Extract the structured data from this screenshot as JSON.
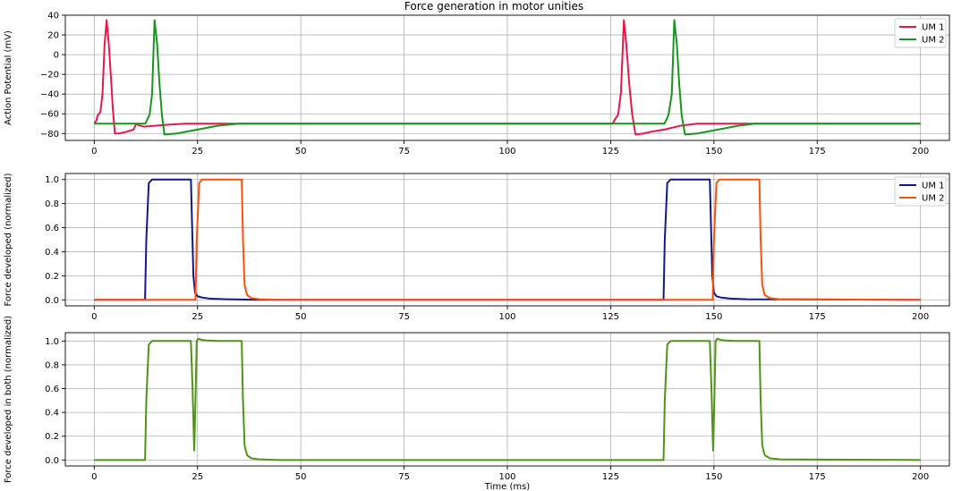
{
  "title": "Force generation in motor unities",
  "chart_data": [
    {
      "type": "line",
      "name": "action-potential",
      "ylabel": "Action Potential (mV)",
      "xlabel": "",
      "xlim": [
        -7,
        207
      ],
      "ylim": [
        -87,
        40
      ],
      "xticks": [
        0,
        25,
        50,
        75,
        100,
        125,
        150,
        175,
        200
      ],
      "yticks": [
        -80,
        -60,
        -40,
        -20,
        0,
        20,
        40
      ],
      "grid": true,
      "legend": "top-right",
      "series": [
        {
          "name": "UM 1",
          "color": "#e8174a",
          "x": [
            0,
            0.5,
            0.8,
            1.5,
            2.0,
            2.5,
            3.0,
            3.5,
            4.0,
            4.5,
            5.0,
            6,
            8,
            9.5,
            10.2,
            11,
            12,
            15,
            18,
            22,
            25,
            30,
            40,
            60,
            80,
            100,
            120,
            125.5,
            126,
            126.8,
            127.5,
            128.2,
            128.8,
            129.5,
            130.2,
            131,
            133,
            135,
            138,
            142,
            146,
            150,
            160,
            200
          ],
          "y": [
            -70,
            -67,
            -62,
            -58,
            -40,
            10,
            35,
            12,
            -20,
            -55,
            -80,
            -80,
            -78,
            -76,
            -70,
            -72,
            -73,
            -72,
            -71,
            -70,
            -70,
            -70,
            -70,
            -70,
            -70,
            -70,
            -70,
            -70,
            -66,
            -61,
            -38,
            35,
            10,
            -30,
            -60,
            -81,
            -80,
            -78,
            -76,
            -72,
            -70,
            -70,
            -70,
            -70
          ]
        },
        {
          "name": "UM 2",
          "color": "#17961e",
          "x": [
            0,
            5,
            10,
            12.4,
            12.8,
            13.4,
            14.0,
            14.6,
            15.2,
            15.8,
            16.4,
            17.0,
            20,
            25,
            30,
            35,
            40,
            60,
            100,
            120,
            138,
            138.5,
            139,
            139.8,
            140.4,
            141.0,
            141.6,
            142.2,
            143,
            146,
            151,
            156,
            160,
            200
          ],
          "y": [
            -70,
            -70,
            -70,
            -70,
            -66,
            -61,
            -40,
            35,
            12,
            -30,
            -62,
            -81,
            -80,
            -76,
            -72,
            -70,
            -70,
            -70,
            -70,
            -70,
            -70,
            -66,
            -61,
            -40,
            35,
            12,
            -30,
            -62,
            -81,
            -80,
            -76,
            -72,
            -70,
            -70
          ]
        }
      ]
    },
    {
      "type": "line",
      "name": "force-each",
      "ylabel": "Force developed (normalized)",
      "xlabel": "",
      "xlim": [
        -7,
        207
      ],
      "ylim": [
        -0.05,
        1.05
      ],
      "xticks": [
        0,
        25,
        50,
        75,
        100,
        125,
        150,
        175,
        200
      ],
      "yticks": [
        0.0,
        0.2,
        0.4,
        0.6,
        0.8,
        1.0
      ],
      "grid": true,
      "legend": "top-right",
      "series": [
        {
          "name": "UM 1",
          "color": "#0f198c",
          "x": [
            0,
            12.3,
            12.6,
            13.2,
            14,
            23.4,
            23.7,
            24.0,
            24.4,
            25.0,
            26,
            28,
            32,
            40,
            137.8,
            138.1,
            138.7,
            139.5,
            149.0,
            149.3,
            149.6,
            150.0,
            150.6,
            151.6,
            154,
            158,
            200
          ],
          "y": [
            0,
            0,
            0.5,
            0.97,
            1.0,
            1.0,
            0.6,
            0.2,
            0.06,
            0.03,
            0.02,
            0.01,
            0.005,
            0,
            0,
            0.5,
            0.97,
            1.0,
            1.0,
            0.6,
            0.2,
            0.06,
            0.03,
            0.02,
            0.01,
            0.005,
            0
          ]
        },
        {
          "name": "UM 2",
          "color": "#ff4f0a",
          "x": [
            0,
            24.5,
            24.8,
            25.4,
            26,
            35.7,
            36.0,
            36.4,
            37.0,
            38,
            40,
            45,
            149.7,
            150.0,
            150.6,
            151.3,
            161.0,
            161.3,
            161.7,
            162.3,
            163.5,
            166,
            200
          ],
          "y": [
            0,
            0,
            0.5,
            0.97,
            1.0,
            1.0,
            0.5,
            0.12,
            0.04,
            0.015,
            0.005,
            0,
            0,
            0.5,
            0.97,
            1.0,
            1.0,
            0.5,
            0.12,
            0.04,
            0.015,
            0.005,
            0
          ]
        }
      ]
    },
    {
      "type": "line",
      "name": "force-both",
      "ylabel": "Force developed in both (normalized)",
      "xlabel": "Time (ms)",
      "xlim": [
        -7,
        207
      ],
      "ylim": [
        -0.05,
        1.07
      ],
      "xticks": [
        0,
        25,
        50,
        75,
        100,
        125,
        150,
        175,
        200
      ],
      "yticks": [
        0.0,
        0.2,
        0.4,
        0.6,
        0.8,
        1.0
      ],
      "grid": true,
      "legend": "",
      "series": [
        {
          "color": "#4e9415",
          "x": [
            0,
            12.3,
            12.6,
            13.2,
            14,
            23.4,
            23.8,
            24.2,
            24.5,
            24.8,
            25.2,
            26,
            27,
            30,
            35.7,
            36.0,
            36.4,
            37.0,
            38,
            40,
            45,
            137.8,
            138.1,
            138.7,
            139.5,
            149.0,
            149.4,
            149.8,
            150.1,
            150.4,
            150.8,
            151.6,
            152.6,
            155,
            161.0,
            161.3,
            161.7,
            162.3,
            163.5,
            166,
            200
          ],
          "y": [
            0,
            0,
            0.5,
            0.97,
            1.0,
            1.0,
            0.6,
            0.08,
            0.5,
            1.0,
            1.02,
            1.01,
            1.005,
            1.0,
            1.0,
            0.5,
            0.12,
            0.04,
            0.015,
            0.005,
            0,
            0,
            0.5,
            0.97,
            1.0,
            1.0,
            0.6,
            0.08,
            0.5,
            1.0,
            1.02,
            1.01,
            1.005,
            1.0,
            1.0,
            0.5,
            0.12,
            0.04,
            0.015,
            0.005,
            0
          ]
        }
      ]
    }
  ]
}
